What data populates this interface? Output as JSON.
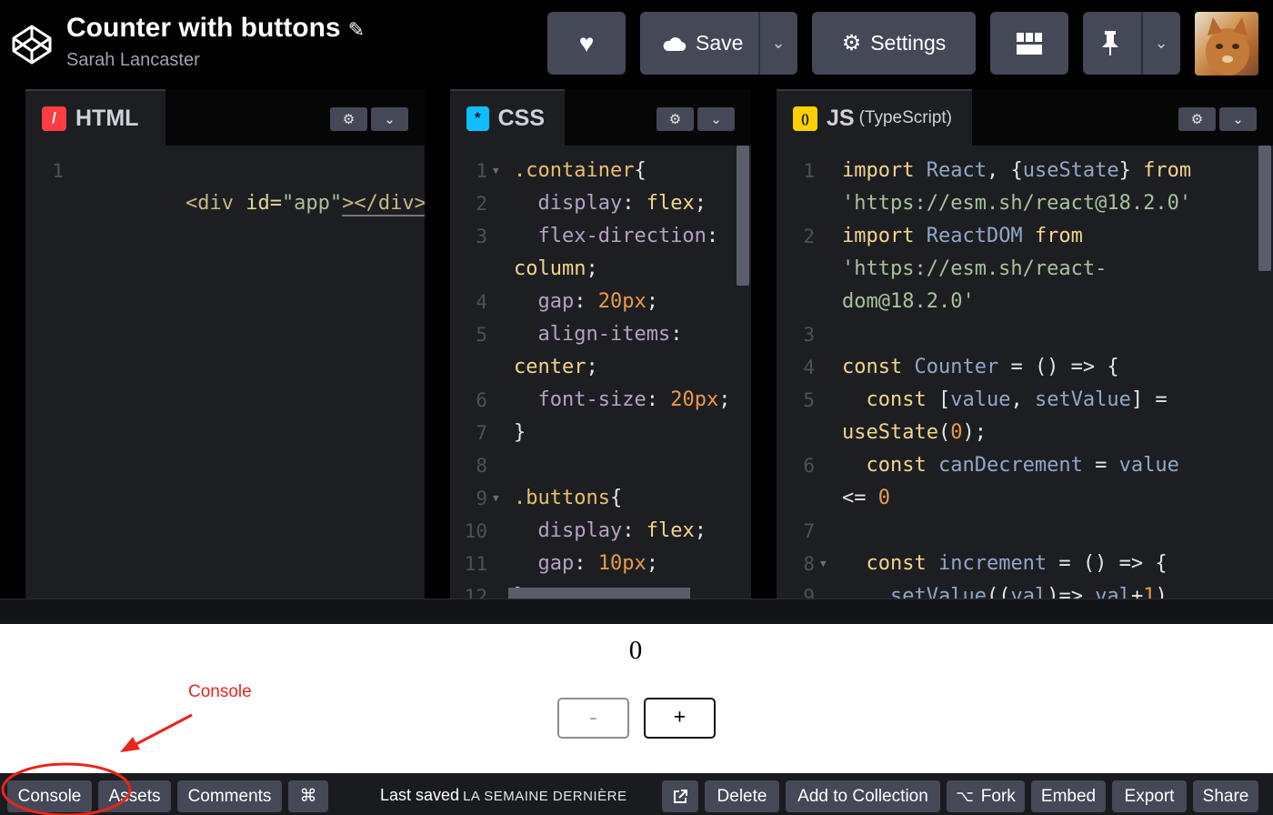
{
  "header": {
    "title": "Counter with buttons",
    "author": "Sarah Lancaster",
    "save_label": "Save",
    "settings_label": "Settings"
  },
  "editors": {
    "html": {
      "name": "HTML",
      "badge": "/",
      "lines": [
        {
          "n": "1"
        }
      ]
    },
    "css": {
      "name": "CSS",
      "badge": "*",
      "line_numbers": [
        "1",
        "2",
        "3",
        "",
        "4",
        "5",
        "",
        "6",
        "7",
        "8",
        "9",
        "10",
        "11",
        "12"
      ]
    },
    "js": {
      "name": "JS",
      "sub": "(TypeScript)",
      "badge": "()",
      "line_numbers": [
        "1",
        "",
        "2",
        "",
        "",
        "3",
        "4",
        "5",
        "",
        "6",
        "",
        "7",
        "8",
        "9"
      ]
    }
  },
  "code": {
    "html_l1": [
      "<div",
      " id=",
      "\"app\"",
      "></div>"
    ],
    "css": [
      [
        ".container",
        "{"
      ],
      [
        "  display",
        ": ",
        "flex",
        ";"
      ],
      [
        "  flex-direction",
        ":"
      ],
      [
        "column",
        ";"
      ],
      [
        "  gap",
        ": ",
        "20px",
        ";"
      ],
      [
        "  align-items",
        ":"
      ],
      [
        "center",
        ";"
      ],
      [
        "  font-size",
        ": ",
        "20px",
        ";"
      ],
      [
        "}"
      ],
      [
        ""
      ],
      [
        ".buttons",
        "{"
      ],
      [
        "  display",
        ": ",
        "flex",
        ";"
      ],
      [
        "  gap",
        ": ",
        "10px",
        ";"
      ],
      [
        "}"
      ]
    ],
    "js": [
      [
        "import ",
        "React",
        ", {",
        "useState",
        "} ",
        "from"
      ],
      [
        "'https://esm.sh/react@18.2.0'"
      ],
      [
        "import ",
        "ReactDOM",
        " from"
      ],
      [
        "'https://esm.sh/react-"
      ],
      [
        "dom@18.2.0'"
      ],
      [
        ""
      ],
      [
        "const ",
        "Counter",
        " = () => {"
      ],
      [
        "  const ",
        "[",
        "value",
        ", ",
        "setValue",
        "] ="
      ],
      [
        "useState",
        "(",
        "0",
        ");"
      ],
      [
        "  const ",
        "canDecrement",
        " = ",
        "value"
      ],
      [
        "<= ",
        "0"
      ],
      [
        ""
      ],
      [
        "  const ",
        "increment",
        " = () => {"
      ],
      [
        "    setValue",
        "((",
        "val",
        ")=> ",
        "val",
        "+",
        "1",
        ")"
      ]
    ]
  },
  "preview": {
    "count": "0",
    "minus_label": "-",
    "plus_label": "+",
    "annotation": "Console"
  },
  "footer": {
    "console": "Console",
    "assets": "Assets",
    "comments": "Comments",
    "shortcut": "⌘",
    "saved_prefix": "Last saved",
    "saved_when": "LA SEMAINE DERNIÈRE",
    "delete": "Delete",
    "add_to_collection": "Add to Collection",
    "fork": "Fork",
    "embed": "Embed",
    "export": "Export",
    "share": "Share"
  },
  "colors": {
    "html_badge": "#ff3c41",
    "css_badge": "#0ebeff",
    "js_badge": "#fcd000",
    "annotation": "#e8251a"
  }
}
